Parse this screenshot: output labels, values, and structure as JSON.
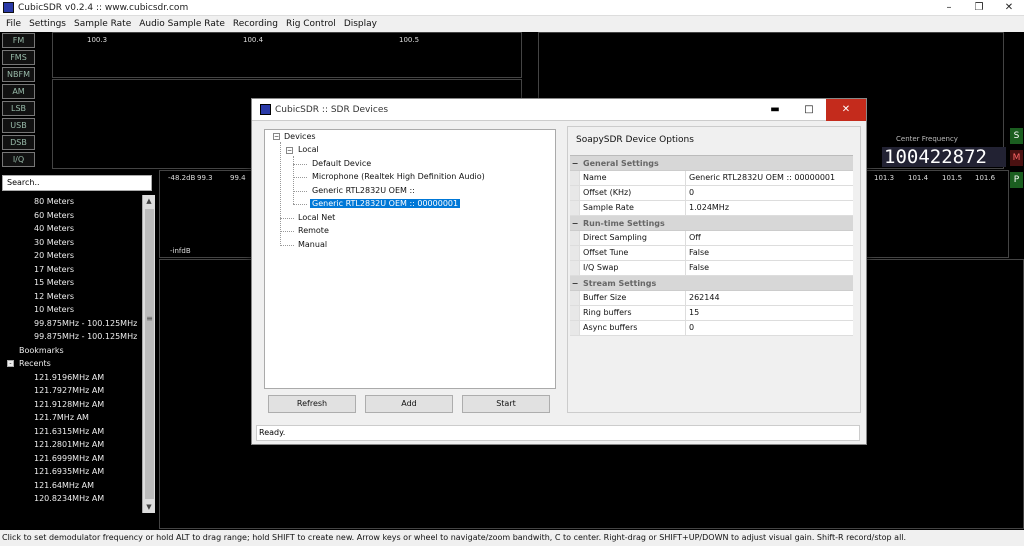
{
  "window": {
    "title": "CubicSDR v0.2.4 :: www.cubicsdr.com",
    "min": "–",
    "max": "❐",
    "close": "✕"
  },
  "menu": [
    "File",
    "Settings",
    "Sample Rate",
    "Audio Sample Rate",
    "Recording",
    "Rig Control",
    "Display"
  ],
  "modes": [
    "FM",
    "FMS",
    "NBFM",
    "AM",
    "LSB",
    "USB",
    "DSB",
    "I/Q"
  ],
  "top_scope_ticks": [
    "100.3",
    "100.4",
    "100.5"
  ],
  "spectrum": {
    "db_top": "-48.2dB",
    "db_bottom": "-infdB",
    "left_ticks": [
      "99.3",
      "99.4"
    ],
    "right_ticks": [
      "101.3",
      "101.4",
      "101.5",
      "101.6"
    ]
  },
  "search": {
    "placeholder": "Search.."
  },
  "tree": {
    "band_items": [
      "80 Meters",
      "60 Meters",
      "40 Meters",
      "30 Meters",
      "20 Meters",
      "17 Meters",
      "15 Meters",
      "12 Meters",
      "10 Meters",
      "99.875MHz - 100.125MHz",
      "99.875MHz - 100.125MHz"
    ],
    "bookmarks_label": "Bookmarks",
    "recents_label": "Recents",
    "recents_expander": "-",
    "recents": [
      "121.9196MHz AM",
      "121.7927MHz AM",
      "121.9128MHz AM",
      "121.7MHz AM",
      "121.6315MHz AM",
      "121.2801MHz AM",
      "121.6999MHz AM",
      "121.6935MHz AM",
      "121.64MHz AM",
      "120.8234MHz AM"
    ]
  },
  "scrollbar": {
    "up": "▲",
    "down": "▼",
    "grip": "≡"
  },
  "center_frequency": {
    "label": "Center  Frequency",
    "value": "100422872"
  },
  "side_buttons": [
    "S",
    "M",
    "P"
  ],
  "status_text": "Click to set demodulator frequency or hold ALT to drag range; hold SHIFT to create new. Arrow keys or wheel to navigate/zoom bandwith, C to center. Right-drag or SHIFT+UP/DOWN to adjust visual gain. Shift-R record/stop all.",
  "dialog": {
    "title": "CubicSDR :: SDR Devices",
    "min": "▬",
    "max": "□",
    "close": "✕",
    "tree": {
      "root": "Devices",
      "local": "Local",
      "devices": [
        "Default Device",
        "Microphone (Realtek High Definition Audio)",
        "Generic RTL2832U OEM ::",
        "Generic RTL2832U OEM :: 00000001"
      ],
      "local_net": "Local Net",
      "remote": "Remote",
      "manual": "Manual",
      "collapse": "−"
    },
    "options_title": "SoapySDR Device Options",
    "groups": [
      {
        "name": "General Settings",
        "rows": [
          [
            "Name",
            "Generic RTL2832U OEM :: 00000001"
          ],
          [
            "Offset (KHz)",
            "0"
          ],
          [
            "Sample Rate",
            "1.024MHz"
          ]
        ]
      },
      {
        "name": "Run-time Settings",
        "rows": [
          [
            "Direct Sampling",
            "Off"
          ],
          [
            "Offset Tune",
            "False"
          ],
          [
            "I/Q Swap",
            "False"
          ]
        ]
      },
      {
        "name": "Stream Settings",
        "rows": [
          [
            "Buffer Size",
            "262144"
          ],
          [
            "Ring buffers",
            "15"
          ],
          [
            "Async buffers",
            "0"
          ]
        ]
      }
    ],
    "group_marker": "−",
    "buttons": {
      "refresh": "Refresh",
      "add": "Add",
      "start": "Start"
    },
    "status": "Ready."
  }
}
